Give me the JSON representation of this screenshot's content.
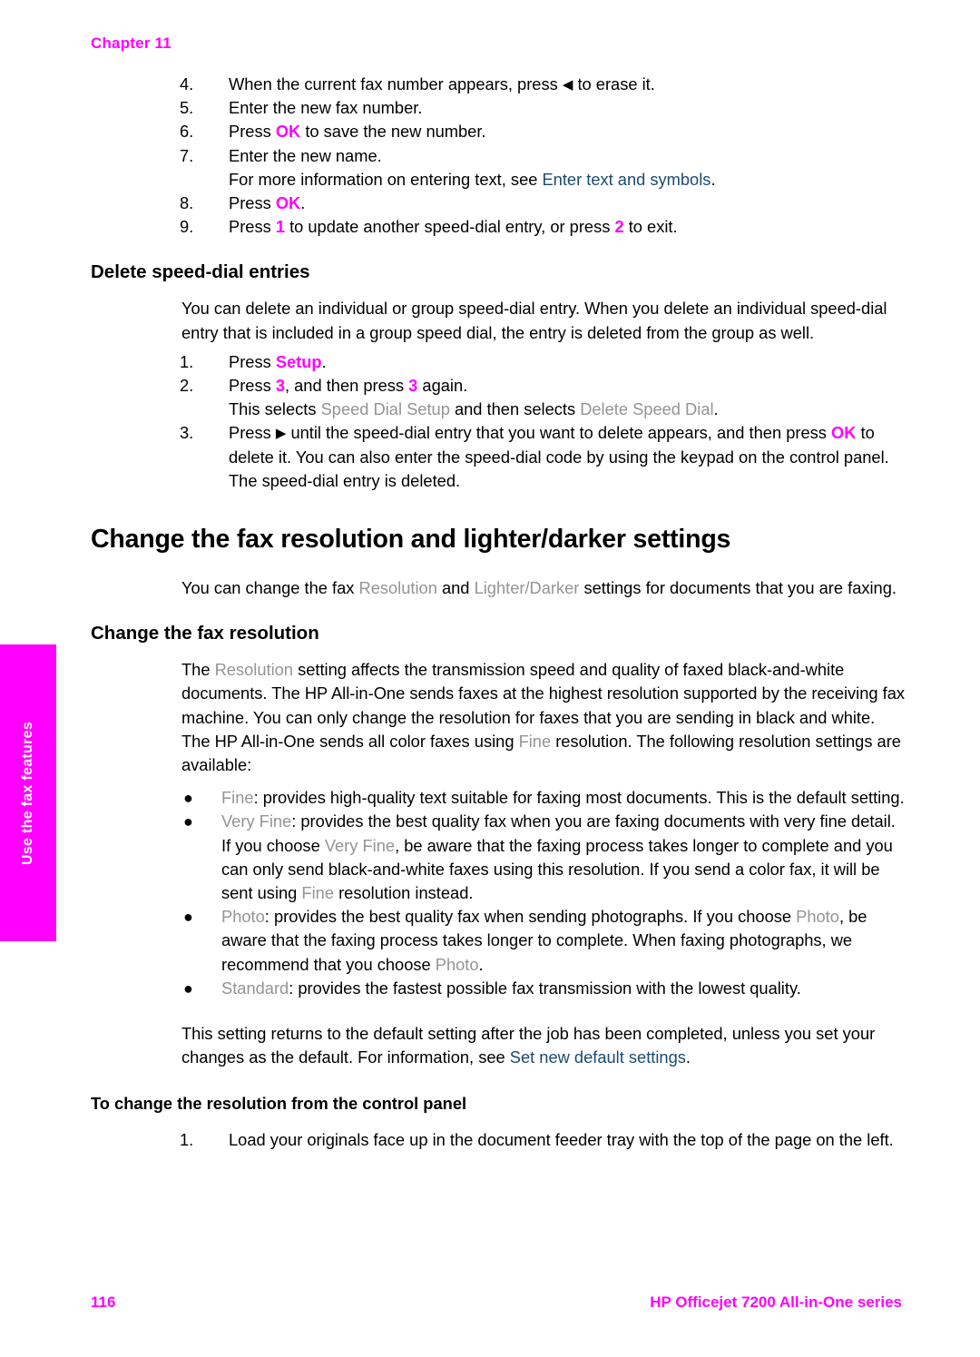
{
  "page": {
    "chapter_label": "Chapter 11",
    "page_number": "116",
    "product_name": "HP Officejet 7200 All-in-One series",
    "side_tab_label": "Use the fax features",
    "colors": {
      "accent_magenta": "#ff00ff",
      "ui_menu_gray": "#949494",
      "xref_blue": "#1b4a6e",
      "body_black": "#000000"
    }
  },
  "steps_top": [
    {
      "number": "4.",
      "parts": [
        {
          "t": "When the current fax number appears, press ",
          "s": "plain"
        },
        {
          "t": "◀",
          "s": "arrow"
        },
        {
          "t": " to erase it.",
          "s": "plain"
        }
      ]
    },
    {
      "number": "5.",
      "parts": [
        {
          "t": "Enter the new fax number.",
          "s": "plain"
        }
      ]
    },
    {
      "number": "6.",
      "parts": [
        {
          "t": "Press ",
          "s": "plain"
        },
        {
          "t": "OK",
          "s": "key"
        },
        {
          "t": " to save the new number.",
          "s": "plain"
        }
      ]
    },
    {
      "number": "7.",
      "parts": [
        {
          "t": "Enter the new name.",
          "s": "plain"
        }
      ]
    },
    {
      "number": "",
      "parts": [
        {
          "t": "For more information on entering text, see ",
          "s": "plain"
        },
        {
          "t": "Enter text and symbols",
          "s": "xref"
        },
        {
          "t": ".",
          "s": "plain"
        }
      ]
    },
    {
      "number": "8.",
      "parts": [
        {
          "t": "Press ",
          "s": "plain"
        },
        {
          "t": "OK",
          "s": "key"
        },
        {
          "t": ".",
          "s": "plain"
        }
      ]
    },
    {
      "number": "9.",
      "parts": [
        {
          "t": "Press ",
          "s": "plain"
        },
        {
          "t": "1",
          "s": "key"
        },
        {
          "t": " to update another speed-dial entry, or press ",
          "s": "plain"
        },
        {
          "t": "2",
          "s": "key"
        },
        {
          "t": " to exit.",
          "s": "plain"
        }
      ]
    }
  ],
  "delete_section": {
    "heading": "Delete speed-dial entries",
    "intro": "You can delete an individual or group speed-dial entry. When you delete an individual speed-dial entry that is included in a group speed dial, the entry is deleted from the group as well.",
    "steps": [
      {
        "number": "1.",
        "parts": [
          {
            "t": "Press ",
            "s": "plain"
          },
          {
            "t": "Setup",
            "s": "key"
          },
          {
            "t": ".",
            "s": "plain"
          }
        ]
      },
      {
        "number": "2.",
        "parts": [
          {
            "t": "Press ",
            "s": "plain"
          },
          {
            "t": "3",
            "s": "key"
          },
          {
            "t": ", and then press ",
            "s": "plain"
          },
          {
            "t": "3",
            "s": "key"
          },
          {
            "t": " again.",
            "s": "plain"
          }
        ]
      },
      {
        "number": "",
        "parts": [
          {
            "t": "This selects ",
            "s": "plain"
          },
          {
            "t": "Speed Dial Setup",
            "s": "menu"
          },
          {
            "t": " and then selects ",
            "s": "plain"
          },
          {
            "t": "Delete Speed Dial",
            "s": "menu"
          },
          {
            "t": ".",
            "s": "plain"
          }
        ]
      },
      {
        "number": "3.",
        "parts": [
          {
            "t": "Press ",
            "s": "plain"
          },
          {
            "t": "▶",
            "s": "arrow"
          },
          {
            "t": " until the speed-dial entry that you want to delete appears, and then press ",
            "s": "plain"
          },
          {
            "t": "OK",
            "s": "key"
          },
          {
            "t": " to delete it. You can also enter the speed-dial code by using the keypad on the control panel.",
            "s": "plain"
          }
        ]
      },
      {
        "number": "",
        "parts": [
          {
            "t": "The speed-dial entry is deleted.",
            "s": "plain"
          }
        ]
      }
    ]
  },
  "resolution_section": {
    "heading": "Change the fax resolution and lighter/darker settings",
    "intro_parts": [
      {
        "t": "You can change the fax ",
        "s": "plain"
      },
      {
        "t": "Resolution",
        "s": "menu"
      },
      {
        "t": " and ",
        "s": "plain"
      },
      {
        "t": "Lighter/Darker",
        "s": "menu"
      },
      {
        "t": " settings for documents that you are faxing.",
        "s": "plain"
      }
    ],
    "sub_heading": "Change the fax resolution",
    "body_parts": [
      {
        "t": "The ",
        "s": "plain"
      },
      {
        "t": "Resolution",
        "s": "menu"
      },
      {
        "t": " setting affects the transmission speed and quality of faxed black-and-white documents. The HP All-in-One sends faxes at the highest resolution supported by the receiving fax machine. You can only change the resolution for faxes that you are sending in black and white. The HP All-in-One sends all color faxes using ",
        "s": "plain"
      },
      {
        "t": "Fine",
        "s": "menu"
      },
      {
        "t": " resolution. The following resolution settings are available:",
        "s": "plain"
      }
    ],
    "bullets": [
      {
        "bullet": "●",
        "parts": [
          {
            "t": "Fine",
            "s": "menu"
          },
          {
            "t": ": provides high-quality text suitable for faxing most documents. This is the default setting.",
            "s": "plain"
          }
        ]
      },
      {
        "bullet": "●",
        "parts": [
          {
            "t": "Very Fine",
            "s": "menu"
          },
          {
            "t": ": provides the best quality fax when you are faxing documents with very fine detail. If you choose ",
            "s": "plain"
          },
          {
            "t": "Very Fine",
            "s": "menu"
          },
          {
            "t": ", be aware that the faxing process takes longer to complete and you can only send black-and-white faxes using this resolution. If you send a color fax, it will be sent using ",
            "s": "plain"
          },
          {
            "t": "Fine",
            "s": "menu"
          },
          {
            "t": " resolution instead.",
            "s": "plain"
          }
        ]
      },
      {
        "bullet": "●",
        "parts": [
          {
            "t": "Photo",
            "s": "menu"
          },
          {
            "t": ": provides the best quality fax when sending photographs. If you choose ",
            "s": "plain"
          },
          {
            "t": "Photo",
            "s": "menu"
          },
          {
            "t": ", be aware that the faxing process takes longer to complete. When faxing photographs, we recommend that you choose ",
            "s": "plain"
          },
          {
            "t": "Photo",
            "s": "menu"
          },
          {
            "t": ".",
            "s": "plain"
          }
        ]
      },
      {
        "bullet": "●",
        "parts": [
          {
            "t": "Standard",
            "s": "menu"
          },
          {
            "t": ": provides the fastest possible fax transmission with the lowest quality.",
            "s": "plain"
          }
        ]
      }
    ],
    "closing_parts": [
      {
        "t": "This setting returns to the default setting after the job has been completed, unless you set your changes as the default. For information, see ",
        "s": "plain"
      },
      {
        "t": "Set new default settings",
        "s": "xref"
      },
      {
        "t": ".",
        "s": "plain"
      }
    ],
    "procedure_heading": "To change the resolution from the control panel",
    "procedure_steps": [
      {
        "number": "1.",
        "parts": [
          {
            "t": "Load your originals face up in the document feeder tray with the top of the page on the left.",
            "s": "plain"
          }
        ]
      }
    ]
  }
}
